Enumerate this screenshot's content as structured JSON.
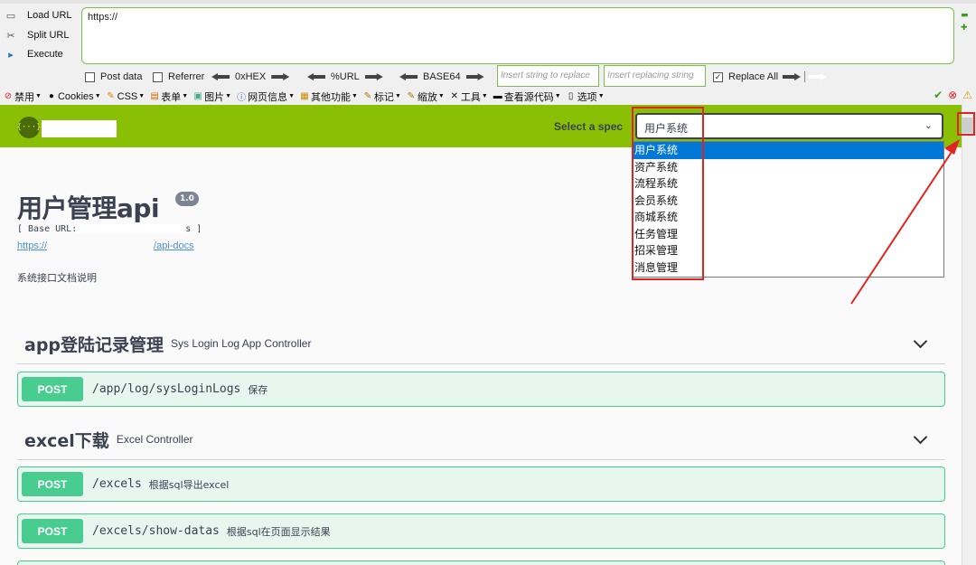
{
  "hackbar": {
    "buttons": [
      {
        "label": "Load URL",
        "icon": "load-icon"
      },
      {
        "label": "Split URL",
        "icon": "scissors-icon"
      },
      {
        "label": "Execute",
        "icon": "play-icon"
      }
    ],
    "url_value": "https://",
    "checkboxes": {
      "post_data": "Post data",
      "referrer": "Referrer",
      "replace_all": "Replace All"
    },
    "encoders": [
      "0xHEX",
      "%URL",
      "BASE64"
    ],
    "insert_placeholder": "Insert string to replace",
    "replacing_placeholder": "Insert replacing string"
  },
  "devbar": {
    "items": [
      "禁用",
      "Cookies",
      "CSS",
      "表单",
      "图片",
      "网页信息",
      "其他功能",
      "标记",
      "缩放",
      "工具",
      "查看源代码",
      "选项"
    ]
  },
  "topbar": {
    "spec_label": "Select a spec",
    "selected_spec": "用户系统",
    "spec_options": [
      "用户系统",
      "资产系统",
      "流程系统",
      "会员系统",
      "商城系统",
      "任务管理",
      "招采管理",
      "消息管理"
    ]
  },
  "info": {
    "title": "用户管理api",
    "version": "1.0",
    "base_url_prefix": "[ Base URL:",
    "base_url_suffix": "s ]",
    "docs_link_prefix": "https://",
    "docs_link_suffix": "/api-docs",
    "description": "系统接口文档说明"
  },
  "sections": [
    {
      "name": "app登陆记录管理",
      "description": "Sys Login Log App Controller",
      "operations": [
        {
          "method": "POST",
          "path": "/app/log/sysLoginLogs",
          "summary": "保存"
        }
      ]
    },
    {
      "name": "excel下载",
      "description": "Excel Controller",
      "operations": [
        {
          "method": "POST",
          "path": "/excels",
          "summary": "根据sql导出excel"
        },
        {
          "method": "POST",
          "path": "/excels/show-datas",
          "summary": "根据sql在页面显示结果"
        }
      ]
    }
  ],
  "colors": {
    "topbar_green": "#89bf04",
    "post_green": "#49cc90",
    "annotation_red": "#e52222",
    "selection_blue": "#0078d7"
  }
}
